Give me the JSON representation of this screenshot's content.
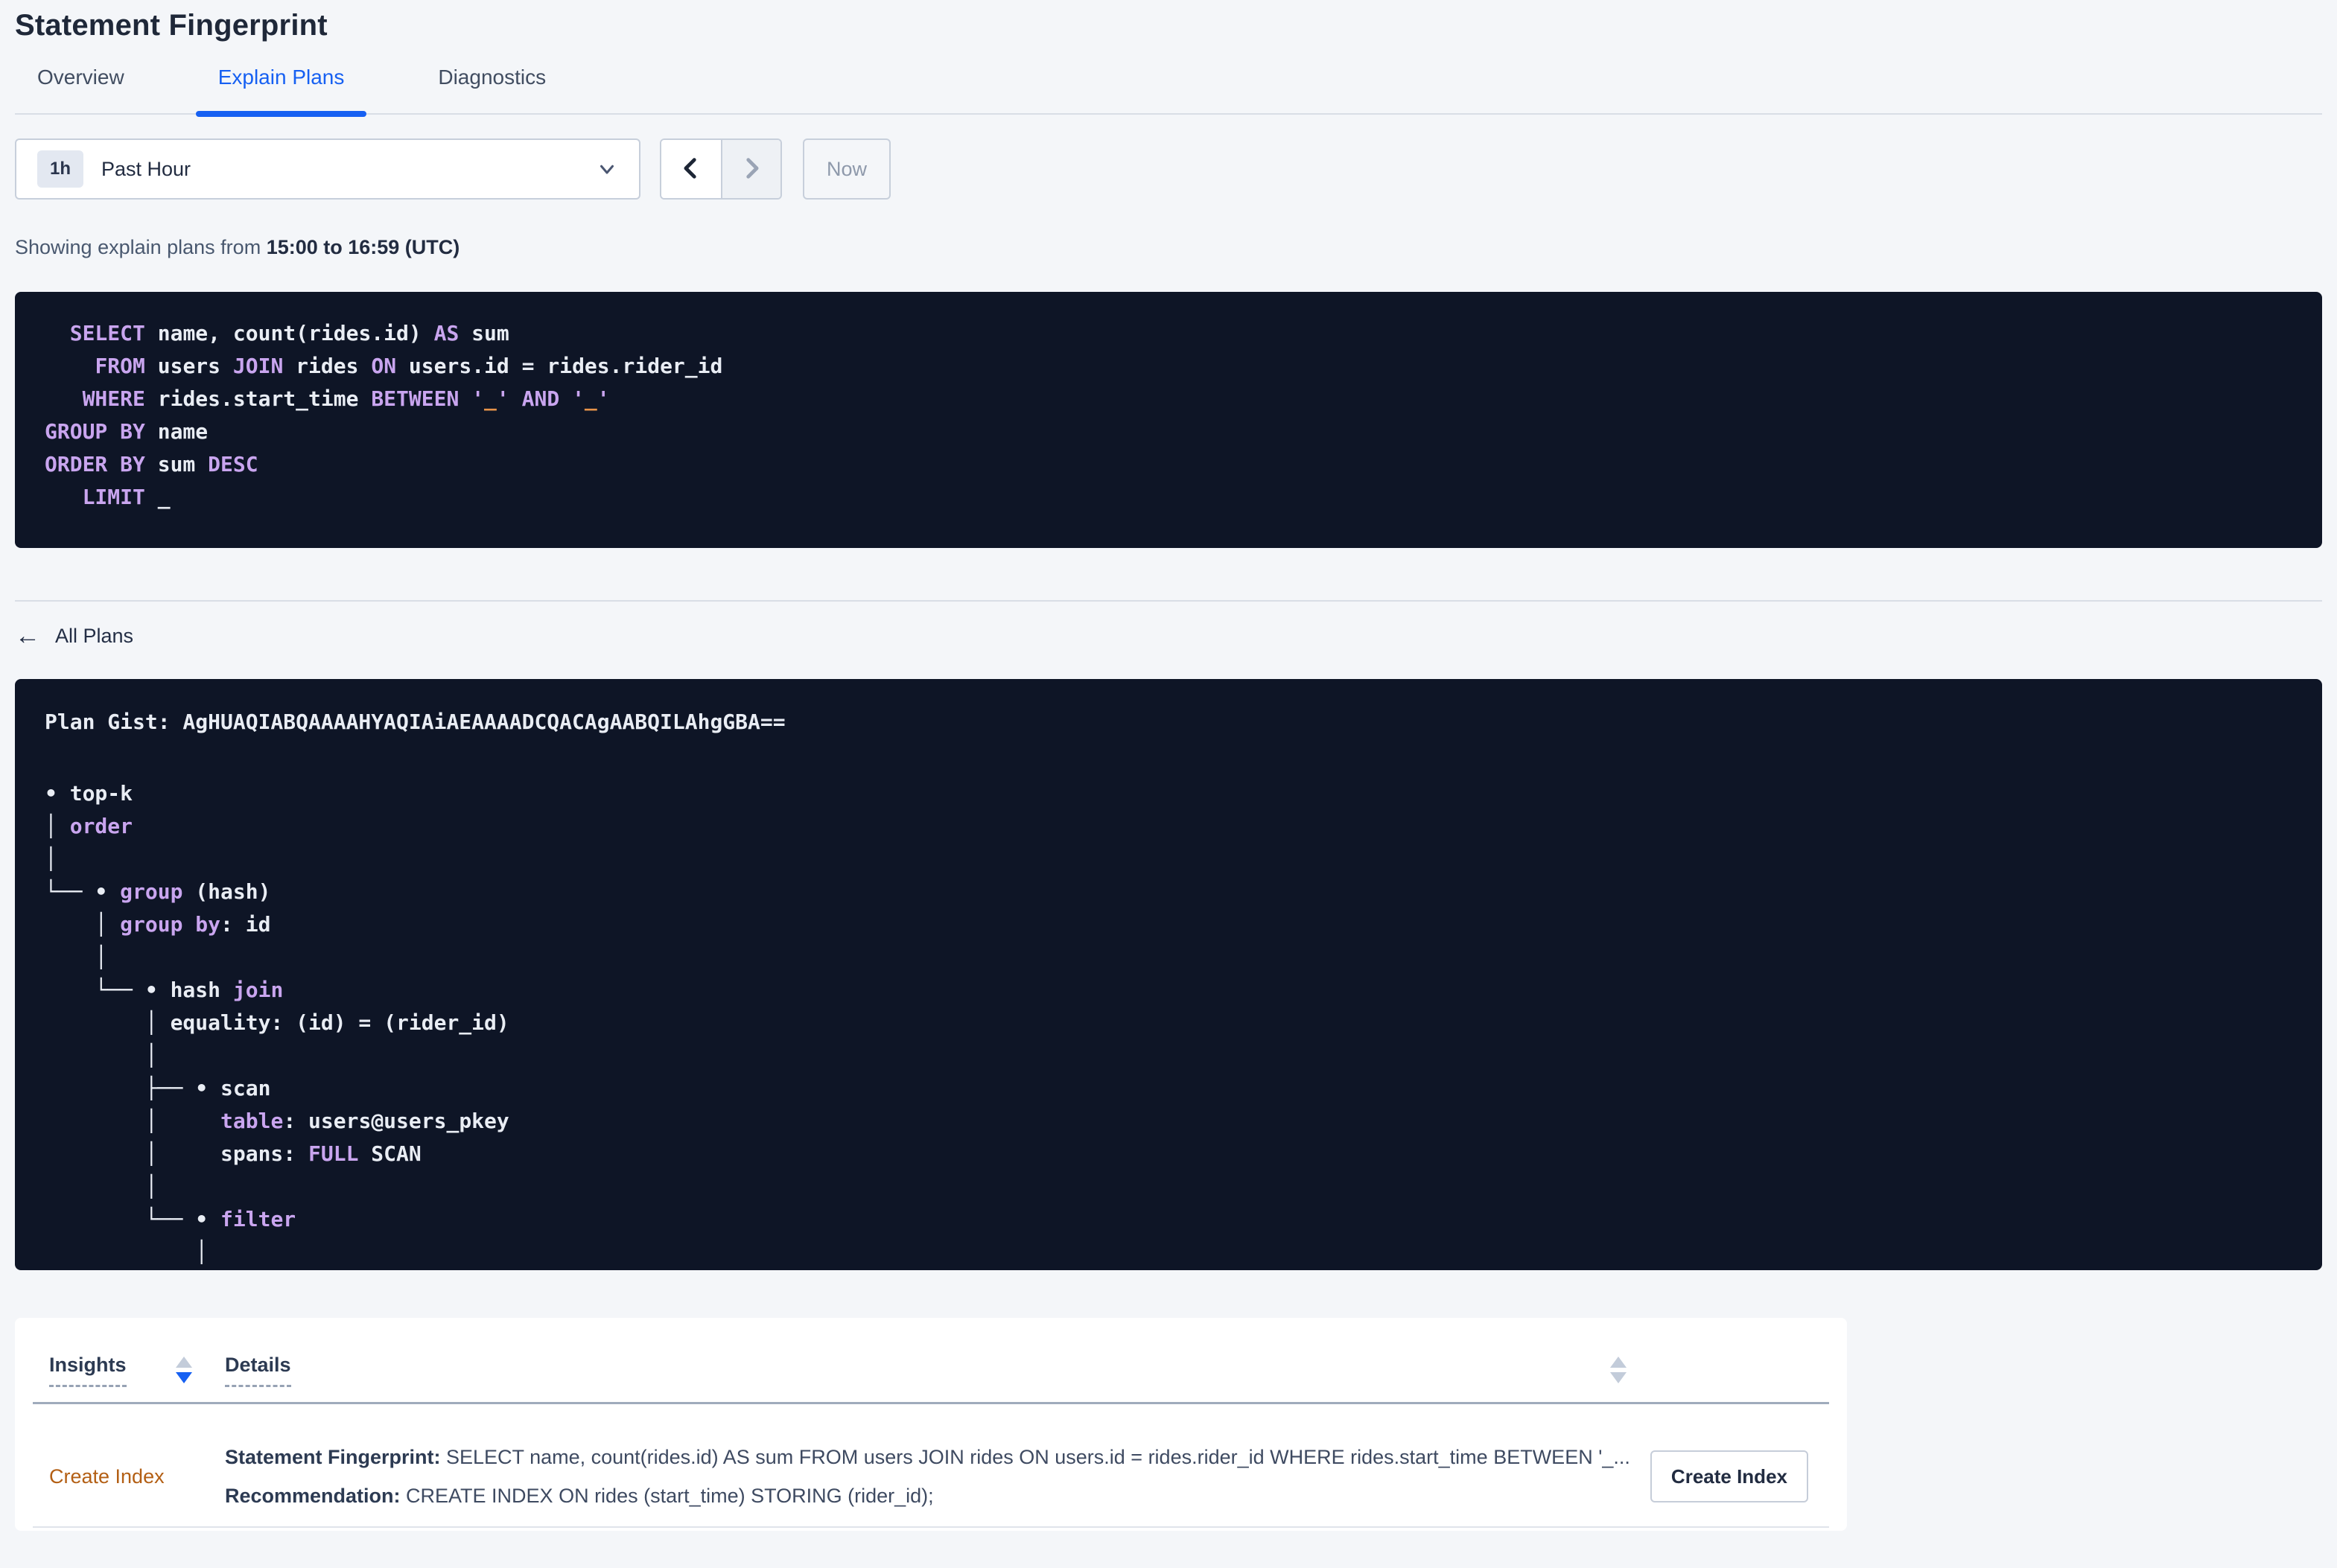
{
  "page": {
    "title": "Statement Fingerprint"
  },
  "colors": {
    "accent_blue": "#1660f2",
    "code_keyword": "#c9a5ef",
    "code_literal": "#e6934a",
    "insight_link_orange": "#b35f14",
    "code_background": "#0e1526"
  },
  "tabs": [
    {
      "label": "Overview",
      "active": false
    },
    {
      "label": "Explain Plans",
      "active": true
    },
    {
      "label": "Diagnostics",
      "active": false
    }
  ],
  "time_picker": {
    "badge": "1h",
    "label": "Past Hour",
    "now_label": "Now",
    "prev_enabled": true,
    "next_enabled": false
  },
  "subtitle": {
    "prefix": "Showing explain plans from ",
    "range": "15:00 to 16:59 (UTC)"
  },
  "sql_block": {
    "lines": [
      [
        [
          "",
          "  "
        ],
        [
          "kw",
          "SELECT"
        ],
        [
          "",
          " name, count(rides.id) "
        ],
        [
          "kw",
          "AS"
        ],
        [
          "",
          " sum"
        ]
      ],
      [
        [
          "",
          "    "
        ],
        [
          "kw",
          "FROM"
        ],
        [
          "",
          " users "
        ],
        [
          "kw",
          "JOIN"
        ],
        [
          "",
          " rides "
        ],
        [
          "kw",
          "ON"
        ],
        [
          "",
          " users.id = rides.rider_id"
        ]
      ],
      [
        [
          "",
          "   "
        ],
        [
          "kw",
          "WHERE"
        ],
        [
          "",
          " rides.start_time "
        ],
        [
          "kw",
          "BETWEEN"
        ],
        [
          "",
          " "
        ],
        [
          "kw",
          "'"
        ],
        [
          "lit",
          "_"
        ],
        [
          "kw",
          "'"
        ],
        [
          "",
          " "
        ],
        [
          "kw",
          "AND"
        ],
        [
          "",
          " "
        ],
        [
          "kw",
          "'"
        ],
        [
          "lit",
          "_"
        ],
        [
          "kw",
          "'"
        ]
      ],
      [
        [
          "kw",
          "GROUP BY"
        ],
        [
          "",
          " name"
        ]
      ],
      [
        [
          "kw",
          "ORDER BY"
        ],
        [
          "",
          " sum "
        ],
        [
          "kw",
          "DESC"
        ]
      ],
      [
        [
          "",
          "   "
        ],
        [
          "kw",
          "LIMIT"
        ],
        [
          "",
          " _"
        ]
      ]
    ]
  },
  "back_link": {
    "icon_glyph": "←",
    "label": "All Plans"
  },
  "plan_block": {
    "gist_lines": [
      [
        [
          "",
          "Plan Gist: AgHUAQIABQAAAAHYAQIAiAEAAAADCQACAgAABQILAhgGBA=="
        ]
      ]
    ],
    "tree_lines": [
      [
        [
          "",
          "• top-k"
        ]
      ],
      [
        [
          "",
          "│ "
        ],
        [
          "kw",
          "order"
        ]
      ],
      [
        [
          "",
          "│"
        ]
      ],
      [
        [
          "",
          "└── • "
        ],
        [
          "kw",
          "group"
        ],
        [
          "",
          " (hash)"
        ]
      ],
      [
        [
          "",
          "    │ "
        ],
        [
          "kw",
          "group by"
        ],
        [
          "",
          ": id"
        ]
      ],
      [
        [
          "",
          "    │"
        ]
      ],
      [
        [
          "",
          "    └── • hash "
        ],
        [
          "kw",
          "join"
        ]
      ],
      [
        [
          "",
          "        │ equality: (id) = (rider_id)"
        ]
      ],
      [
        [
          "",
          "        │"
        ]
      ],
      [
        [
          "",
          "        ├── • scan"
        ]
      ],
      [
        [
          "",
          "        │     "
        ],
        [
          "kw",
          "table"
        ],
        [
          "",
          ": users@users_pkey"
        ]
      ],
      [
        [
          "",
          "        │     spans: "
        ],
        [
          "kw",
          "FULL"
        ],
        [
          "",
          " SCAN"
        ]
      ],
      [
        [
          "",
          "        │"
        ]
      ],
      [
        [
          "",
          "        └── • "
        ],
        [
          "kw",
          "filter"
        ]
      ],
      [
        [
          "",
          "            │"
        ]
      ],
      [
        [
          "",
          "            │"
        ]
      ]
    ]
  },
  "insights_table": {
    "columns": [
      {
        "label": "Insights",
        "sort": "desc"
      },
      {
        "label": "Details",
        "sort": "none"
      }
    ],
    "rows": [
      {
        "insight": "Create Index",
        "details": [
          {
            "label": "Statement Fingerprint:",
            "text": " SELECT name, count(rides.id) AS sum FROM users JOIN rides ON users.id = rides.rider_id WHERE rides.start_time BETWEEN '_..."
          },
          {
            "label": "Recommendation:",
            "text": " CREATE INDEX ON rides (start_time) STORING (rider_id);"
          }
        ],
        "action_label": "Create Index"
      }
    ]
  }
}
